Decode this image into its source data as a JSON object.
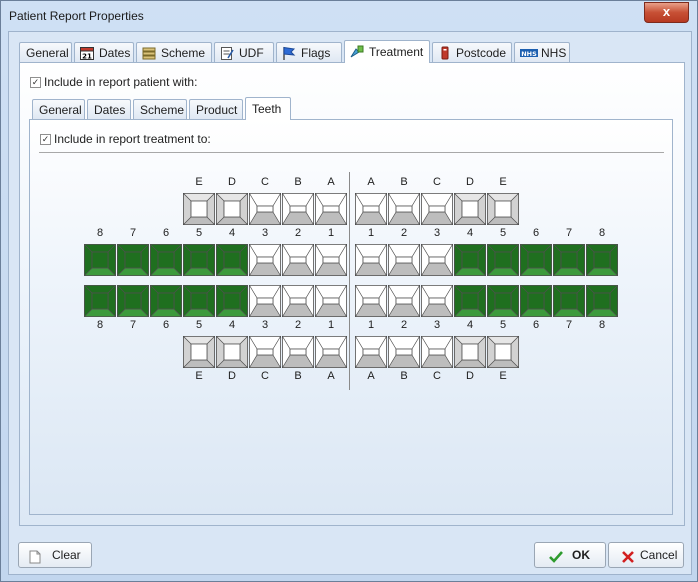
{
  "window": {
    "title": "Patient Report Properties",
    "close_glyph": "x"
  },
  "main_tabs": [
    {
      "label": "General",
      "icon": "none"
    },
    {
      "label": "Dates",
      "icon": "calendar-icon",
      "icon_text": "21"
    },
    {
      "label": "Scheme",
      "icon": "scheme-icon"
    },
    {
      "label": "UDF",
      "icon": "udf-icon"
    },
    {
      "label": "Flags",
      "icon": "flag-icon"
    },
    {
      "label": "Treatment",
      "icon": "treatment-icon",
      "active": true
    },
    {
      "label": "Postcode",
      "icon": "postcode-icon"
    },
    {
      "label": "NHS",
      "icon": "nhs-icon",
      "icon_text": "NHS"
    }
  ],
  "include_patient": {
    "label": "Include in report patient with:",
    "checked": true
  },
  "sub_tabs": [
    {
      "label": "General"
    },
    {
      "label": "Dates"
    },
    {
      "label": "Scheme"
    },
    {
      "label": "Product"
    },
    {
      "label": "Teeth",
      "active": true
    }
  ],
  "include_treatment": {
    "label": "Include in report treatment to:",
    "checked": true
  },
  "dental_chart": {
    "deciduous_letters": [
      "E",
      "D",
      "C",
      "B",
      "A"
    ],
    "permanent_numbers": [
      "8",
      "7",
      "6",
      "5",
      "4",
      "3",
      "2",
      "1"
    ],
    "upper_right_primary": {
      "letters": [
        "E",
        "D",
        "C",
        "B",
        "A"
      ],
      "types": [
        "molar",
        "molar",
        "incisor",
        "incisor",
        "incisor"
      ],
      "selected": [
        false,
        false,
        false,
        false,
        false
      ]
    },
    "upper_left_primary": {
      "letters": [
        "A",
        "B",
        "C",
        "D",
        "E"
      ],
      "types": [
        "incisor",
        "incisor",
        "incisor",
        "molar",
        "molar"
      ],
      "selected": [
        false,
        false,
        false,
        false,
        false
      ]
    },
    "upper_right_perm": {
      "numbers": [
        "8",
        "7",
        "6",
        "5",
        "4",
        "3",
        "2",
        "1"
      ],
      "types": [
        "molar",
        "molar",
        "molar",
        "molar",
        "molar",
        "incisor",
        "incisor",
        "incisor"
      ],
      "selected": [
        true,
        true,
        true,
        true,
        true,
        false,
        false,
        false
      ]
    },
    "upper_left_perm": {
      "numbers": [
        "1",
        "2",
        "3",
        "4",
        "5",
        "6",
        "7",
        "8"
      ],
      "types": [
        "incisor",
        "incisor",
        "incisor",
        "molar",
        "molar",
        "molar",
        "molar",
        "molar"
      ],
      "selected": [
        false,
        false,
        false,
        true,
        true,
        true,
        true,
        true
      ]
    },
    "lower_right_perm": {
      "numbers": [
        "8",
        "7",
        "6",
        "5",
        "4",
        "3",
        "2",
        "1"
      ],
      "types": [
        "molar",
        "molar",
        "molar",
        "molar",
        "molar",
        "incisor",
        "incisor",
        "incisor"
      ],
      "selected": [
        true,
        true,
        true,
        true,
        true,
        false,
        false,
        false
      ]
    },
    "lower_left_perm": {
      "numbers": [
        "1",
        "2",
        "3",
        "4",
        "5",
        "6",
        "7",
        "8"
      ],
      "types": [
        "incisor",
        "incisor",
        "incisor",
        "molar",
        "molar",
        "molar",
        "molar",
        "molar"
      ],
      "selected": [
        false,
        false,
        false,
        true,
        true,
        true,
        true,
        true
      ]
    },
    "lower_right_primary": {
      "letters": [
        "E",
        "D",
        "C",
        "B",
        "A"
      ],
      "types": [
        "molar",
        "molar",
        "incisor",
        "incisor",
        "incisor"
      ],
      "selected": [
        false,
        false,
        false,
        false,
        false
      ]
    },
    "lower_left_primary": {
      "letters": [
        "A",
        "B",
        "C",
        "D",
        "E"
      ],
      "types": [
        "incisor",
        "incisor",
        "incisor",
        "molar",
        "molar"
      ],
      "selected": [
        false,
        false,
        false,
        false,
        false
      ]
    },
    "colors": {
      "selected": "#1f6f1f",
      "selected_light": "#3c9a3c",
      "unselected": "#f2f2f2",
      "outline": "#505050"
    }
  },
  "buttons": {
    "clear": {
      "label": "Clear",
      "icon": "page-icon"
    },
    "ok": {
      "label": "OK",
      "icon": "checkmark-icon"
    },
    "cancel": {
      "label": "Cancel",
      "icon": "cross-icon"
    }
  }
}
